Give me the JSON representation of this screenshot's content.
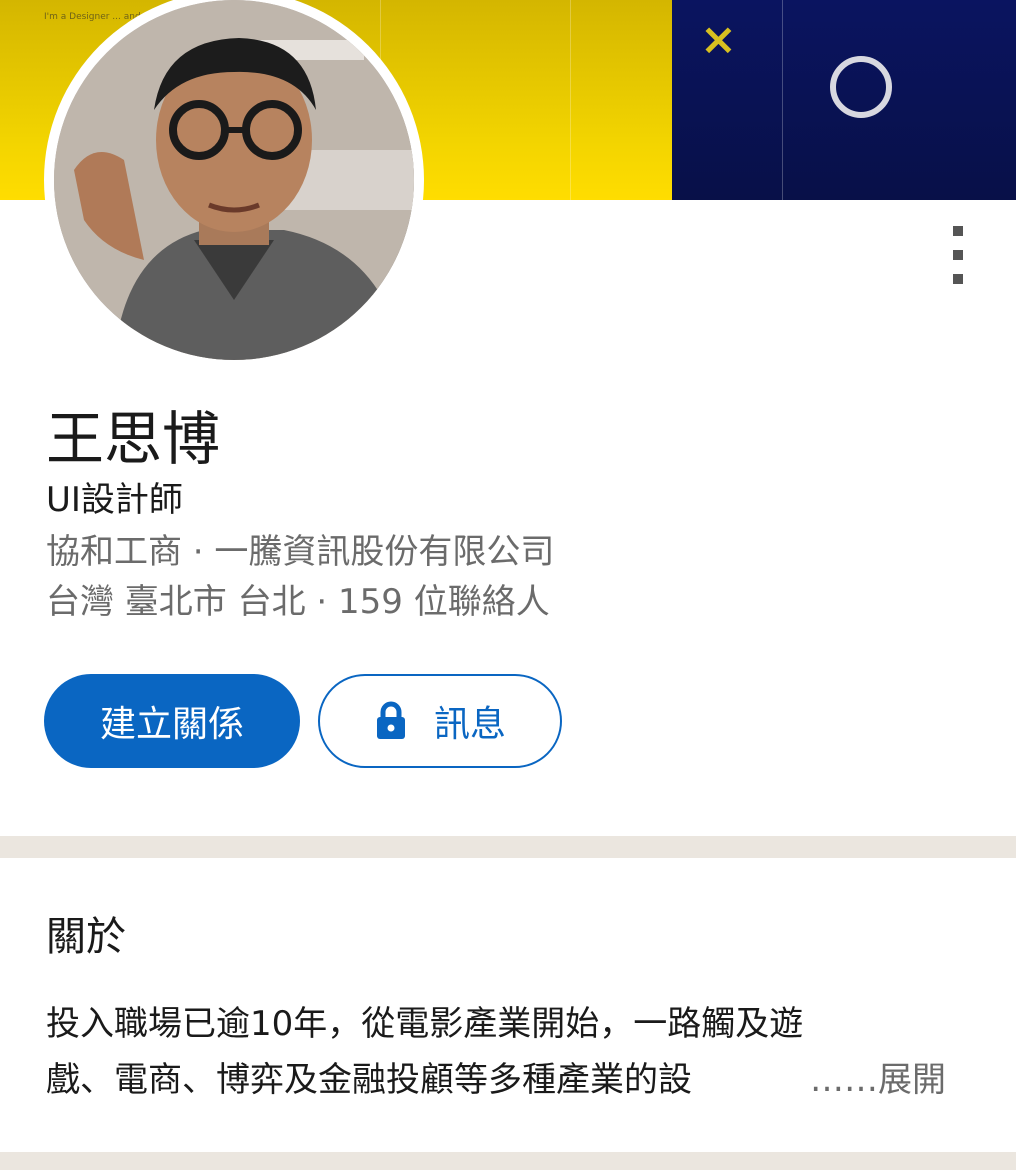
{
  "banner": {
    "tiny_text": "I'm a Designer ... and UI/UX ... and Figma",
    "x_glyph": "×",
    "colors": {
      "yellow": "#f2d400",
      "navy": "#0a1460"
    }
  },
  "profile": {
    "name": "王思博",
    "headline": "UI設計師",
    "school_company": "協和工商 · 一騰資訊股份有限公司",
    "location_connections": "台灣 臺北市 台北 · 159 位聯絡人"
  },
  "actions": {
    "connect_label": "建立關係",
    "message_label": "訊息",
    "lock_icon": "lock-icon",
    "more_icon": "more-vertical-icon"
  },
  "about": {
    "title": "關於",
    "line1": "投入職場已逾10年，從電影產業開始，一路觸及遊",
    "line2": "戲、電商、博弈及金融投顧等多種產業的設",
    "see_more": "……展開"
  },
  "theme": {
    "primary": "#0a66c2",
    "divider": "#ebe6df"
  }
}
